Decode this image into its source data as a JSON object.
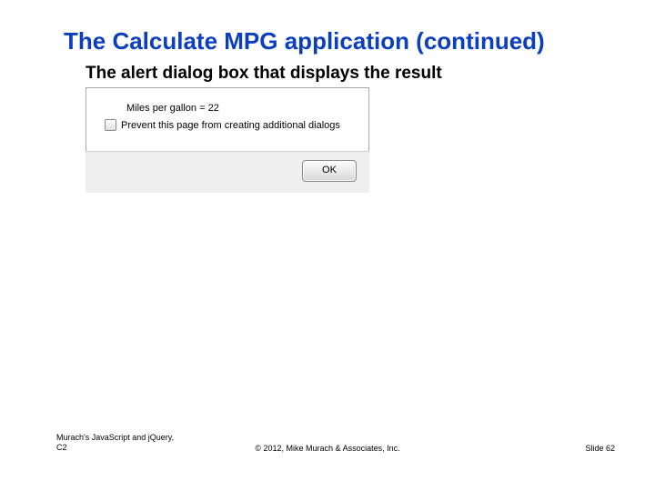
{
  "title": "The Calculate MPG application (continued)",
  "section_heading": "The alert dialog box that displays the result",
  "dialog": {
    "message": "Miles per gallon = 22",
    "prevent_label": "Prevent this page from creating additional dialogs",
    "ok_label": "OK"
  },
  "footer": {
    "left_line1": "Murach's JavaScript and jQuery,",
    "left_line2": "C2",
    "center": "© 2012, Mike Murach & Associates, Inc.",
    "right": "Slide 62"
  }
}
